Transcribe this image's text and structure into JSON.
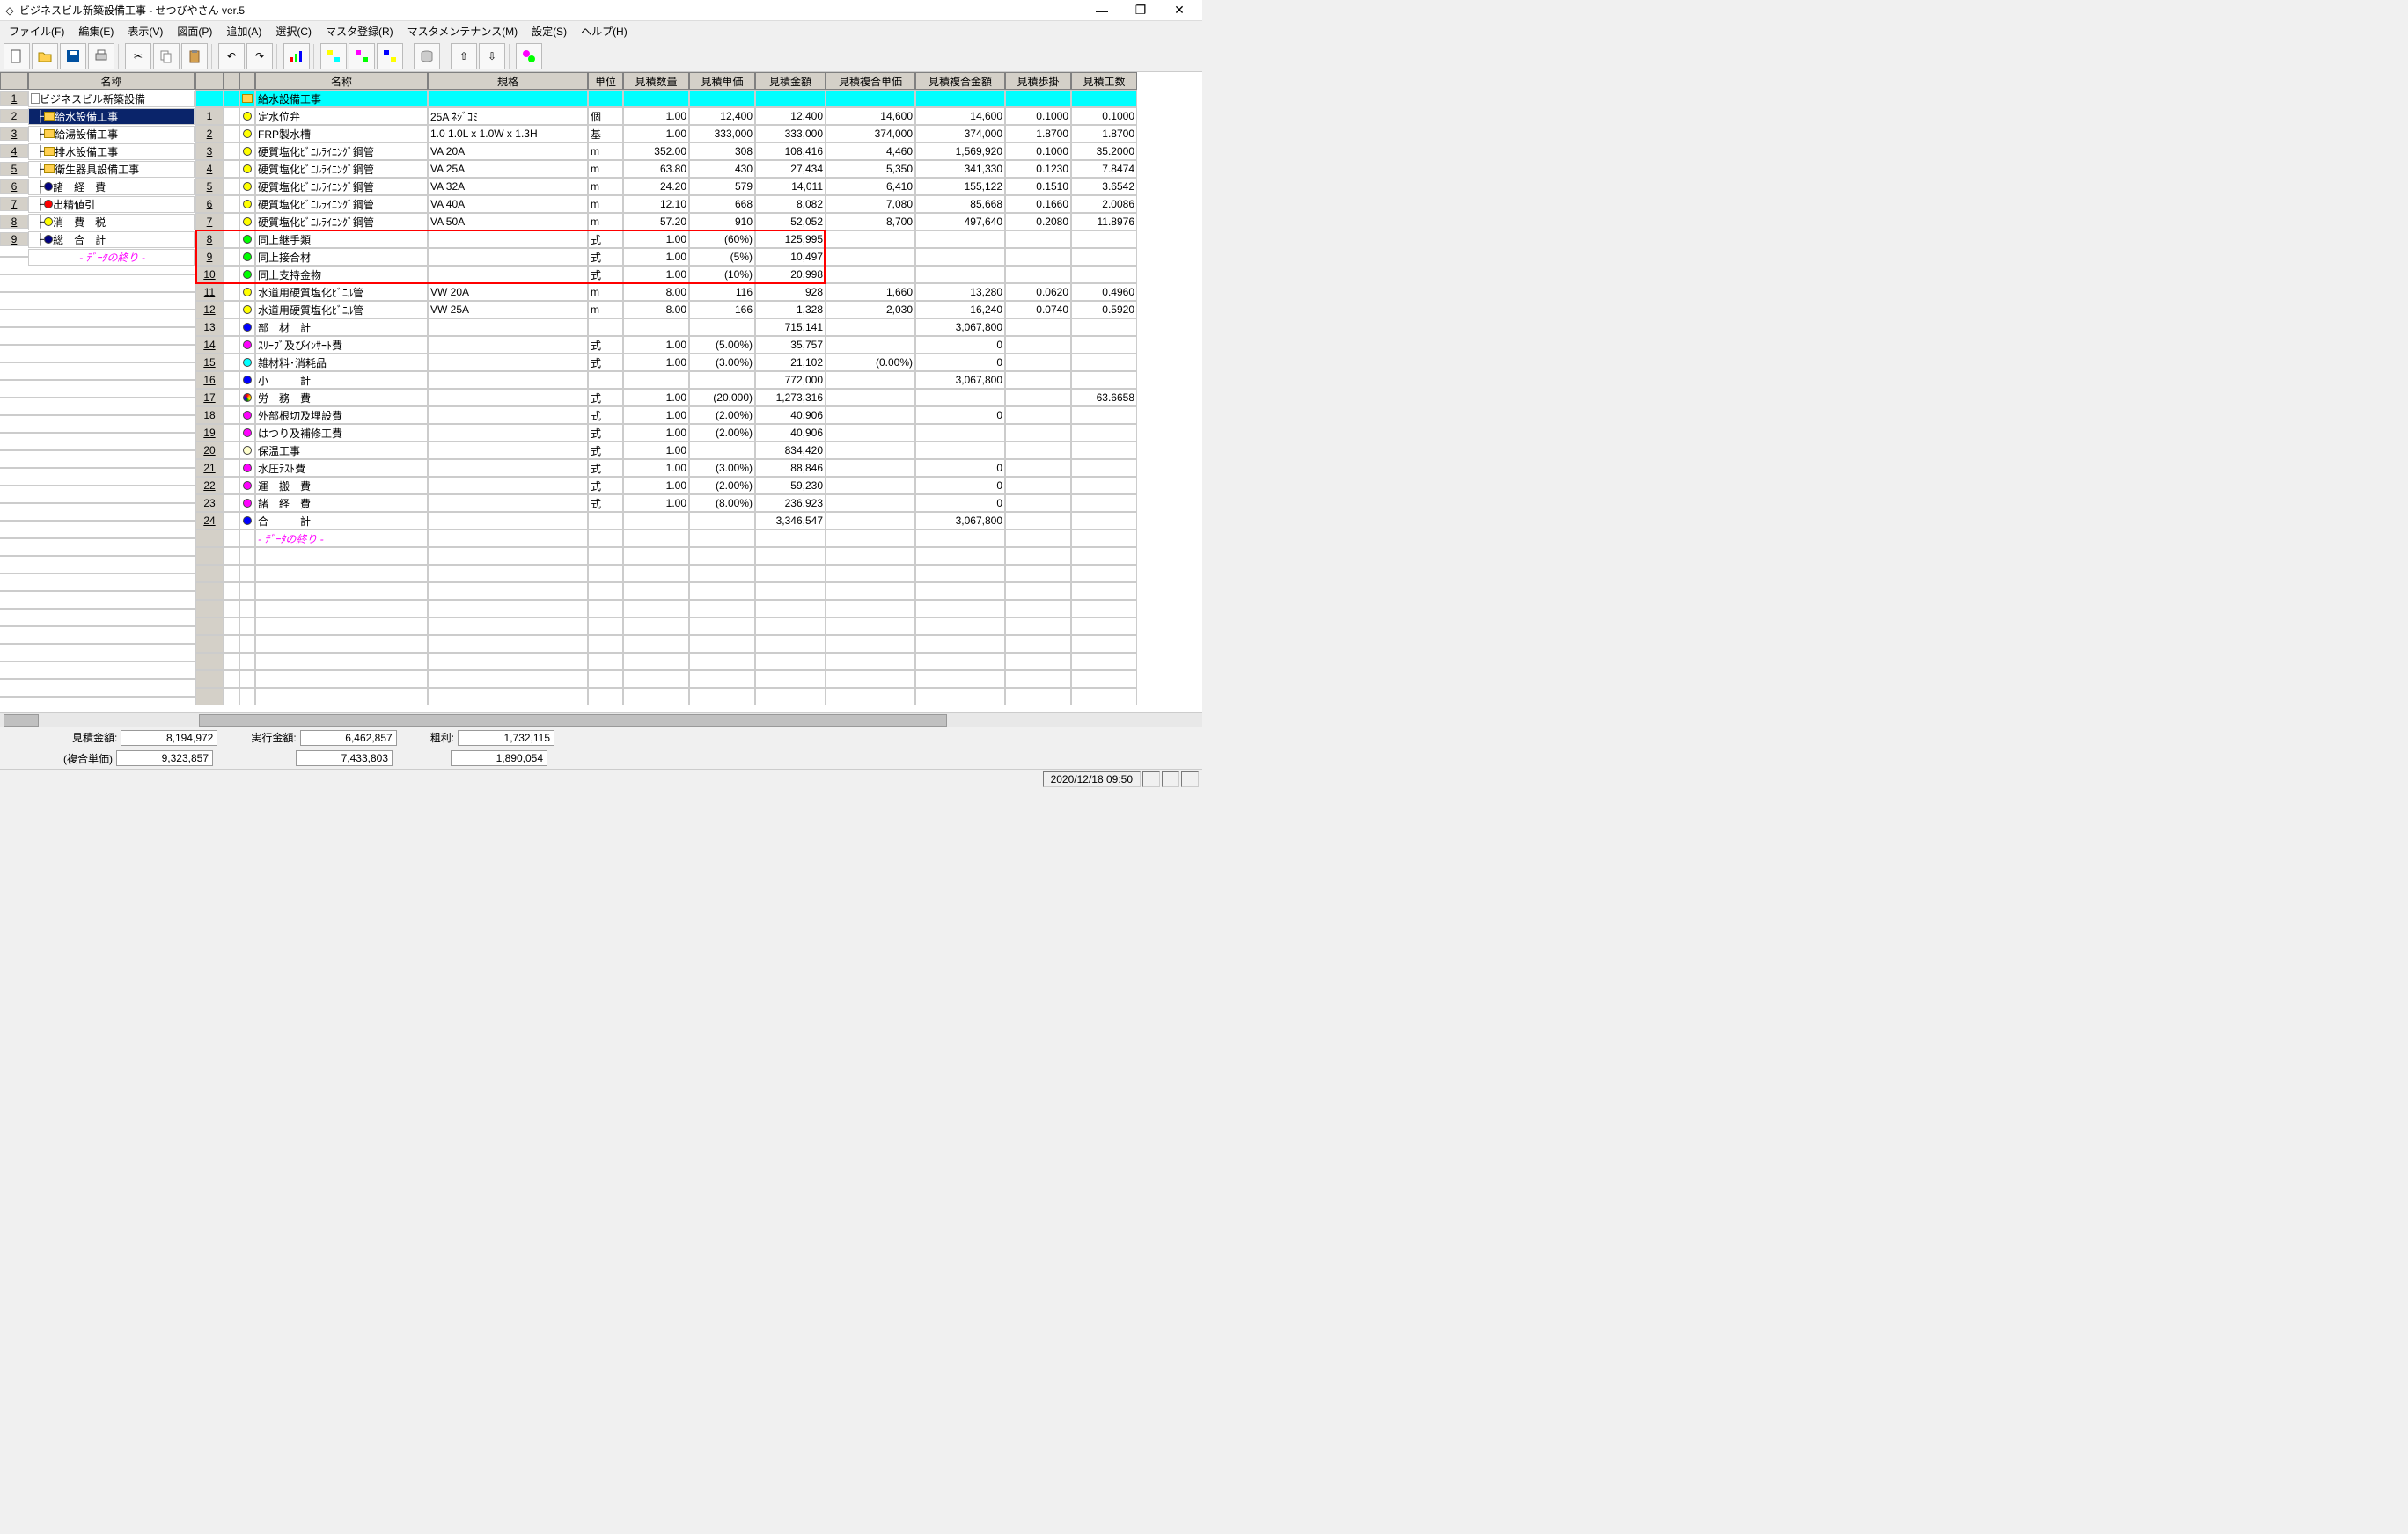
{
  "app": {
    "title": "ビジネスビル新築設備工事 - せつびやさん ver.5"
  },
  "menu": [
    "ファイル(F)",
    "編集(E)",
    "表示(V)",
    "図面(P)",
    "追加(A)",
    "選択(C)",
    "マスタ登録(R)",
    "マスタメンテナンス(M)",
    "設定(S)",
    "ヘルプ(H)"
  ],
  "tree": {
    "header": "名称",
    "rows": [
      {
        "n": "1",
        "indent": 0,
        "icon": "doc",
        "text": "ビジネスビル新築設備"
      },
      {
        "n": "2",
        "indent": 1,
        "icon": "folder",
        "text": "給水設備工事",
        "selected": true
      },
      {
        "n": "3",
        "indent": 1,
        "icon": "folder",
        "text": "給湯設備工事"
      },
      {
        "n": "4",
        "indent": 1,
        "icon": "folder",
        "text": "排水設備工事"
      },
      {
        "n": "5",
        "indent": 1,
        "icon": "folder",
        "text": "衛生器具設備工事"
      },
      {
        "n": "6",
        "indent": 1,
        "icon": "navy",
        "text": "諸　経　費"
      },
      {
        "n": "7",
        "indent": 1,
        "icon": "red",
        "text": "出精値引"
      },
      {
        "n": "8",
        "indent": 1,
        "icon": "yellow",
        "text": "消　費　税"
      },
      {
        "n": "9",
        "indent": 1,
        "icon": "navy",
        "text": "総　合　計"
      }
    ],
    "end": "- ﾃﾞｰﾀの終り -"
  },
  "grid": {
    "cols": [
      {
        "k": "num",
        "w": 32,
        "label": ""
      },
      {
        "k": "ic",
        "w": 18,
        "label": ""
      },
      {
        "k": "ic2",
        "w": 18,
        "label": ""
      },
      {
        "k": "name",
        "w": 196,
        "label": "名称"
      },
      {
        "k": "spec",
        "w": 182,
        "label": "規格"
      },
      {
        "k": "unit",
        "w": 40,
        "label": "単位"
      },
      {
        "k": "qty",
        "w": 75,
        "label": "見積数量"
      },
      {
        "k": "uprice",
        "w": 75,
        "label": "見積単価"
      },
      {
        "k": "amt",
        "w": 80,
        "label": "見積金額"
      },
      {
        "k": "cup",
        "w": 102,
        "label": "見積複合単価"
      },
      {
        "k": "camt",
        "w": 102,
        "label": "見積複合金額"
      },
      {
        "k": "rate",
        "w": 75,
        "label": "見積歩掛"
      },
      {
        "k": "man",
        "w": 75,
        "label": "見積工数"
      }
    ],
    "title_row": {
      "ic": "folder",
      "name": "給水設備工事"
    },
    "rows": [
      {
        "n": "1",
        "dot": "yellow",
        "name": "定水位弁",
        "spec": "25A ﾈｼﾞｺﾐ",
        "unit": "個",
        "qty": "1.00",
        "uprice": "12,400",
        "amt": "12,400",
        "cup": "14,600",
        "camt": "14,600",
        "rate": "0.1000",
        "man": "0.1000"
      },
      {
        "n": "2",
        "dot": "yellow",
        "name": "FRP製水槽",
        "spec": "1.0 1.0L x 1.0W x 1.3H",
        "unit": "基",
        "qty": "1.00",
        "uprice": "333,000",
        "amt": "333,000",
        "cup": "374,000",
        "camt": "374,000",
        "rate": "1.8700",
        "man": "1.8700"
      },
      {
        "n": "3",
        "dot": "yellow",
        "name": "硬質塩化ﾋﾞﾆﾙﾗｲﾆﾝｸﾞ鋼管",
        "spec": "VA 20A",
        "unit": "m",
        "qty": "352.00",
        "uprice": "308",
        "amt": "108,416",
        "cup": "4,460",
        "camt": "1,569,920",
        "rate": "0.1000",
        "man": "35.2000"
      },
      {
        "n": "4",
        "dot": "yellow",
        "name": "硬質塩化ﾋﾞﾆﾙﾗｲﾆﾝｸﾞ鋼管",
        "spec": "VA 25A",
        "unit": "m",
        "qty": "63.80",
        "uprice": "430",
        "amt": "27,434",
        "cup": "5,350",
        "camt": "341,330",
        "rate": "0.1230",
        "man": "7.8474"
      },
      {
        "n": "5",
        "dot": "yellow",
        "name": "硬質塩化ﾋﾞﾆﾙﾗｲﾆﾝｸﾞ鋼管",
        "spec": "VA 32A",
        "unit": "m",
        "qty": "24.20",
        "uprice": "579",
        "amt": "14,011",
        "cup": "6,410",
        "camt": "155,122",
        "rate": "0.1510",
        "man": "3.6542"
      },
      {
        "n": "6",
        "dot": "yellow",
        "name": "硬質塩化ﾋﾞﾆﾙﾗｲﾆﾝｸﾞ鋼管",
        "spec": "VA 40A",
        "unit": "m",
        "qty": "12.10",
        "uprice": "668",
        "amt": "8,082",
        "cup": "7,080",
        "camt": "85,668",
        "rate": "0.1660",
        "man": "2.0086"
      },
      {
        "n": "7",
        "dot": "yellow",
        "name": "硬質塩化ﾋﾞﾆﾙﾗｲﾆﾝｸﾞ鋼管",
        "spec": "VA 50A",
        "unit": "m",
        "qty": "57.20",
        "uprice": "910",
        "amt": "52,052",
        "cup": "8,700",
        "camt": "497,640",
        "rate": "0.2080",
        "man": "11.8976"
      },
      {
        "n": "8",
        "dot": "green",
        "name": "同上継手類",
        "spec": "",
        "unit": "式",
        "qty": "1.00",
        "uprice": "(60%)",
        "amt": "125,995",
        "cup": "",
        "camt": "",
        "rate": "",
        "man": "",
        "hl": "first"
      },
      {
        "n": "9",
        "dot": "green",
        "name": "同上接合材",
        "spec": "",
        "unit": "式",
        "qty": "1.00",
        "uprice": "(5%)",
        "amt": "10,497",
        "cup": "",
        "camt": "",
        "rate": "",
        "man": "",
        "hl": "mid"
      },
      {
        "n": "10",
        "dot": "green",
        "name": "同上支持金物",
        "spec": "",
        "unit": "式",
        "qty": "1.00",
        "uprice": "(10%)",
        "amt": "20,998",
        "cup": "",
        "camt": "",
        "rate": "",
        "man": "",
        "hl": "last"
      },
      {
        "n": "11",
        "dot": "yellow",
        "name": "水道用硬質塩化ﾋﾞﾆﾙ管",
        "spec": "VW 20A",
        "unit": "m",
        "qty": "8.00",
        "uprice": "116",
        "amt": "928",
        "cup": "1,660",
        "camt": "13,280",
        "rate": "0.0620",
        "man": "0.4960"
      },
      {
        "n": "12",
        "dot": "yellow",
        "name": "水道用硬質塩化ﾋﾞﾆﾙ管",
        "spec": "VW 25A",
        "unit": "m",
        "qty": "8.00",
        "uprice": "166",
        "amt": "1,328",
        "cup": "2,030",
        "camt": "16,240",
        "rate": "0.0740",
        "man": "0.5920"
      },
      {
        "n": "13",
        "dot": "blue",
        "name": "部　材　計",
        "spec": "",
        "unit": "",
        "qty": "",
        "uprice": "",
        "amt": "715,141",
        "cup": "",
        "camt": "3,067,800",
        "rate": "",
        "man": ""
      },
      {
        "n": "14",
        "dot": "magenta",
        "name": "ｽﾘｰﾌﾞ及びｲﾝｻｰﾄ費",
        "spec": "",
        "unit": "式",
        "qty": "1.00",
        "uprice": "(5.00%)",
        "amt": "35,757",
        "cup": "",
        "camt": "0",
        "rate": "",
        "man": ""
      },
      {
        "n": "15",
        "dot": "cyan",
        "name": "雑材料･消耗品",
        "spec": "",
        "unit": "式",
        "qty": "1.00",
        "uprice": "(3.00%)",
        "amt": "21,102",
        "cup": "(0.00%)",
        "camt": "0",
        "rate": "",
        "man": ""
      },
      {
        "n": "16",
        "dot": "blue",
        "name": "小　　　計",
        "spec": "",
        "unit": "",
        "qty": "",
        "uprice": "",
        "amt": "772,000",
        "cup": "",
        "camt": "3,067,800",
        "rate": "",
        "man": ""
      },
      {
        "n": "17",
        "dot": "rainbow",
        "name": "労　務　費",
        "spec": "",
        "unit": "式",
        "qty": "1.00",
        "uprice": "(20,000)",
        "amt": "1,273,316",
        "cup": "",
        "camt": "",
        "rate": "",
        "man": "63.6658"
      },
      {
        "n": "18",
        "dot": "magenta",
        "name": "外部根切及埋設費",
        "spec": "",
        "unit": "式",
        "qty": "1.00",
        "uprice": "(2.00%)",
        "amt": "40,906",
        "cup": "",
        "camt": "0",
        "rate": "",
        "man": ""
      },
      {
        "n": "19",
        "dot": "magenta",
        "name": "はつり及補修工費",
        "spec": "",
        "unit": "式",
        "qty": "1.00",
        "uprice": "(2.00%)",
        "amt": "40,906",
        "cup": "",
        "camt": "",
        "rate": "",
        "man": ""
      },
      {
        "n": "20",
        "dot": "pale",
        "name": "保温工事",
        "spec": "",
        "unit": "式",
        "qty": "1.00",
        "uprice": "",
        "amt": "834,420",
        "cup": "",
        "camt": "",
        "rate": "",
        "man": ""
      },
      {
        "n": "21",
        "dot": "magenta",
        "name": "水圧ﾃｽﾄ費",
        "spec": "",
        "unit": "式",
        "qty": "1.00",
        "uprice": "(3.00%)",
        "amt": "88,846",
        "cup": "",
        "camt": "0",
        "rate": "",
        "man": ""
      },
      {
        "n": "22",
        "dot": "magenta",
        "name": "運　搬　費",
        "spec": "",
        "unit": "式",
        "qty": "1.00",
        "uprice": "(2.00%)",
        "amt": "59,230",
        "cup": "",
        "camt": "0",
        "rate": "",
        "man": ""
      },
      {
        "n": "23",
        "dot": "magenta",
        "name": "諸　経　費",
        "spec": "",
        "unit": "式",
        "qty": "1.00",
        "uprice": "(8.00%)",
        "amt": "236,923",
        "cup": "",
        "camt": "0",
        "rate": "",
        "man": ""
      },
      {
        "n": "24",
        "dot": "blue",
        "name": "合　　　計",
        "spec": "",
        "unit": "",
        "qty": "",
        "uprice": "",
        "amt": "3,346,547",
        "cup": "",
        "camt": "3,067,800",
        "rate": "",
        "man": ""
      }
    ],
    "end": "- ﾃﾞｰﾀの終り -"
  },
  "status": {
    "labels": {
      "est": "見積金額:",
      "exec": "実行金額:",
      "gross": "粗利:",
      "cup": "(複合単価)"
    },
    "est": "8,194,972",
    "exec": "6,462,857",
    "gross": "1,732,115",
    "est2": "9,323,857",
    "exec2": "7,433,803",
    "gross2": "1,890,054",
    "datetime": "2020/12/18 09:50"
  }
}
